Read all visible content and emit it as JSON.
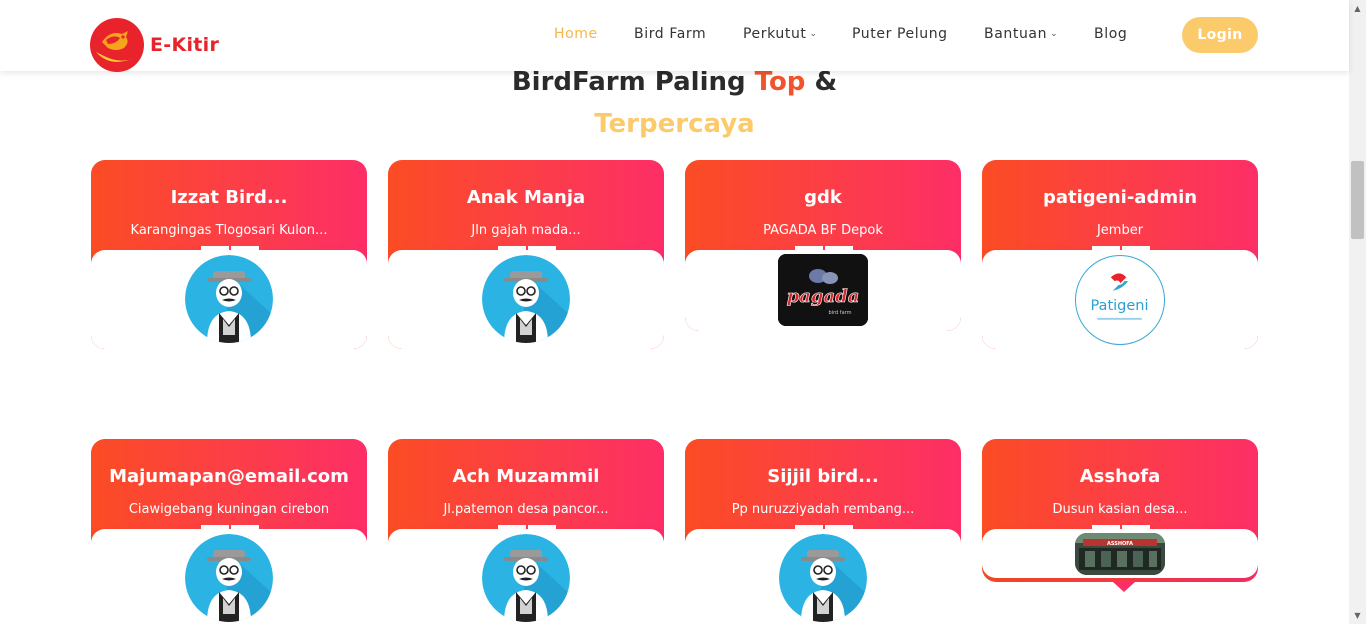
{
  "brand": {
    "name": "E-Kitir",
    "logo_icon": "bird-logo-icon",
    "color": "#e8232c"
  },
  "nav": {
    "items": [
      {
        "label": "Home",
        "active": true,
        "dropdown": false
      },
      {
        "label": "Bird Farm",
        "active": false,
        "dropdown": false
      },
      {
        "label": "Perkutut",
        "active": false,
        "dropdown": true
      },
      {
        "label": "Puter Pelung",
        "active": false,
        "dropdown": false
      },
      {
        "label": "Bantuan",
        "active": false,
        "dropdown": true
      },
      {
        "label": "Blog",
        "active": false,
        "dropdown": false
      }
    ],
    "login_label": "Login"
  },
  "heading": {
    "part1": "BirdFarm Paling ",
    "accent": "Top",
    "part2": " &",
    "line2": "Terpercaya"
  },
  "colors": {
    "accent_yellow": "#fbcb6b",
    "accent_orange": "#f1542c",
    "card_gradient_start": "#fb4c24",
    "card_gradient_end": "#fd2e66"
  },
  "farms": [
    {
      "name": "Izzat Bird...",
      "location": "Karangingas Tlogosari Kulon...",
      "image": "default-avatar"
    },
    {
      "name": "Anak Manja",
      "location": "Jln gajah mada...",
      "image": "default-avatar"
    },
    {
      "name": "gdk",
      "location": "PAGADA BF Depok",
      "image": "pagada-logo",
      "image_text": "pagada",
      "image_subtext": "bird farm"
    },
    {
      "name": "patigeni-admin",
      "location": "Jember",
      "image": "patigeni-logo",
      "image_text": "Patigeni"
    },
    {
      "name": "Majumapan@email.com",
      "location": "Ciawigebang kuningan cirebon",
      "image": "default-avatar"
    },
    {
      "name": "Ach Muzammil",
      "location": "Jl.patemon desa pancor...",
      "image": "default-avatar"
    },
    {
      "name": "Sijjil bird...",
      "location": "Pp nuruzziyadah rembang...",
      "image": "default-avatar"
    },
    {
      "name": "Asshofa",
      "location": "Dusun kasian desa...",
      "image": "asshofa-photo",
      "image_text": "ASSHOFA"
    }
  ]
}
